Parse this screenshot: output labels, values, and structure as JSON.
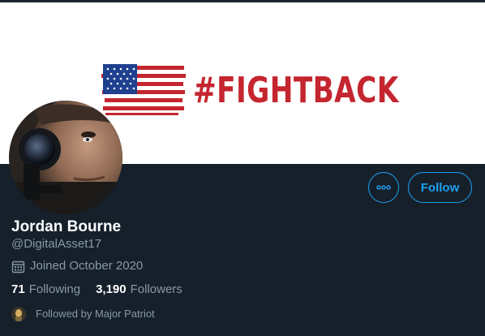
{
  "profile": {
    "banner_hashtag": "#FIGHTBACK",
    "name": "Jordan Bourne",
    "handle": "@DigitalAsset17",
    "joined": "Joined October 2020",
    "following_count": "71",
    "following_label": "Following",
    "followers_count": "3,190",
    "followers_label": "Followers",
    "followed_by": "Followed by Major Patriot"
  },
  "actions": {
    "more_icon": "more-options-icon",
    "follow_label": "Follow"
  },
  "icons": {
    "calendar": "calendar-icon",
    "flag": "american-flag-icon"
  },
  "colors": {
    "background": "#15202b",
    "accent": "#1da1f2",
    "secondary_text": "#8899a6",
    "hashtag_red": "#c4252f"
  }
}
